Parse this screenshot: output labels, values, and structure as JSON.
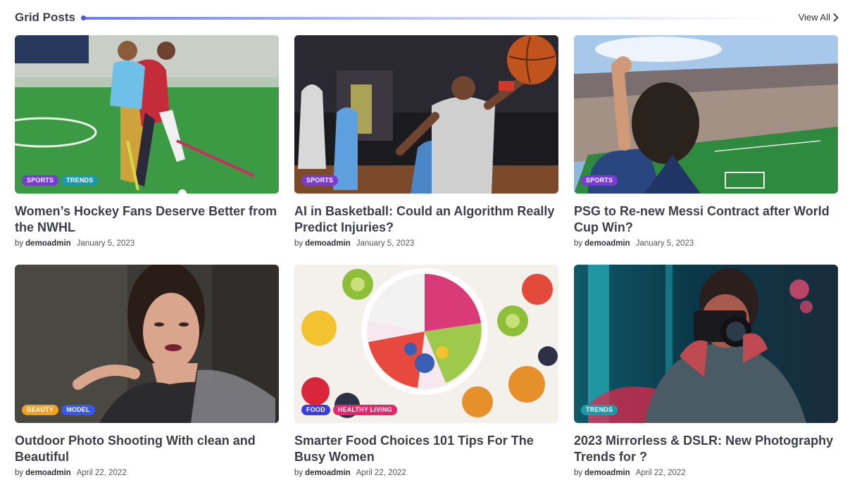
{
  "section": {
    "title": "Grid Posts",
    "view_all": "View All"
  },
  "colors": {
    "sports": "#7a3ad6",
    "trends": "#1b9ba9",
    "beauty": "#f3a11e",
    "model": "#3657e8",
    "food": "#3a3ee0",
    "healthy_living": "#e5266b"
  },
  "posts": [
    {
      "title": "Women’s Hockey Fans Deserve Better from the NWHL",
      "by": "by",
      "author": "demoadmin",
      "date": "January 5, 2023",
      "tags": [
        "SPORTS",
        "TRENDS"
      ],
      "image": "field-hockey-players"
    },
    {
      "title": "AI in Basketball: Could an Algorithm Really Predict Injuries?",
      "by": "by",
      "author": "demoadmin",
      "date": "January 5, 2023",
      "tags": [
        "SPORTS"
      ],
      "image": "basketball-player-dunk"
    },
    {
      "title": "PSG to Re-new Messi Contract after World Cup Win?",
      "by": "by",
      "author": "demoadmin",
      "date": "January 5, 2023",
      "tags": [
        "SPORTS"
      ],
      "image": "football-stadium-fan"
    },
    {
      "title": "Outdoor Photo Shooting With clean and Beautiful",
      "by": "by",
      "author": "demoadmin",
      "date": "April 22, 2022",
      "tags": [
        "BEAUTY",
        "MODEL"
      ],
      "image": "woman-portrait"
    },
    {
      "title": "Smarter Food Choices 101 Tips For The Busy Women",
      "by": "by",
      "author": "demoadmin",
      "date": "April 22, 2022",
      "tags": [
        "FOOD",
        "HEALTHY LIVING"
      ],
      "image": "fruit-bowl"
    },
    {
      "title": "2023 Mirrorless & DSLR: New Photography Trends for ?",
      "by": "by",
      "author": "demoadmin",
      "date": "April 22, 2022",
      "tags": [
        "TRENDS"
      ],
      "image": "photographer-neon"
    }
  ]
}
